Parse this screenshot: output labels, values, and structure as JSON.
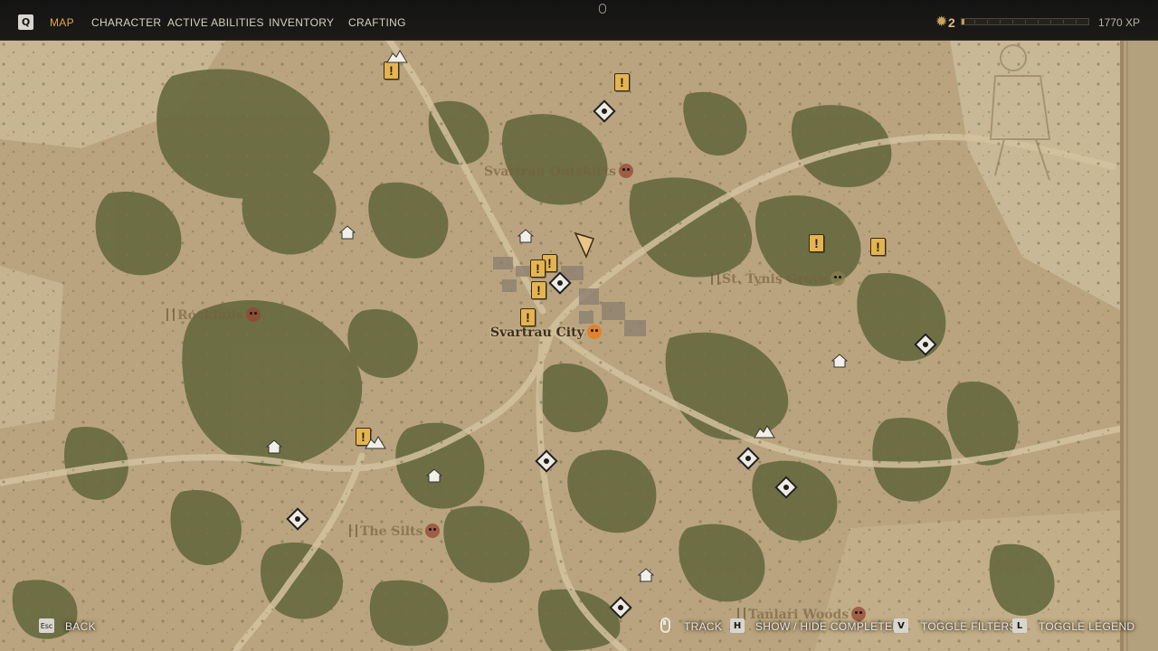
{
  "topbar": {
    "key_hint": "Q",
    "tabs": [
      {
        "label": "MAP",
        "active": true
      },
      {
        "label": "CHARACTER",
        "active": false
      },
      {
        "label": "ACTIVE ABILITIES",
        "active": false
      },
      {
        "label": "INVENTORY",
        "active": false
      },
      {
        "label": "CRAFTING",
        "active": false
      }
    ],
    "level": "2",
    "xp_text": "1770 XP",
    "xp_progress": 0.02,
    "accent_color": "#e0a94a"
  },
  "map": {
    "locations": {
      "outskirts": "Svartrau Outskirts",
      "grove": "St. Tynis Grove",
      "rockfalls": "Rockfalls",
      "city": "Svartrau City",
      "silts": "The Silts",
      "woods": "Tanlari Woods"
    },
    "quest_glyph": "!",
    "icons": {
      "quest": "quest-marker-icon",
      "house": "house-icon",
      "poi": "point-of-interest-icon",
      "camp": "camp-icon",
      "player": "player-arrow-icon",
      "skull": "skull-icon"
    }
  },
  "controls": {
    "back_key": "Esc",
    "back_label": "BACK",
    "track_label": "TRACK",
    "show_hide_key": "H",
    "show_hide_label": "SHOW / HIDE COMPLETED",
    "filters_key": "V",
    "filters_label": "TOGGLE FILTERS",
    "legend_key": "L",
    "legend_label": "TOGGLE LEGEND"
  }
}
